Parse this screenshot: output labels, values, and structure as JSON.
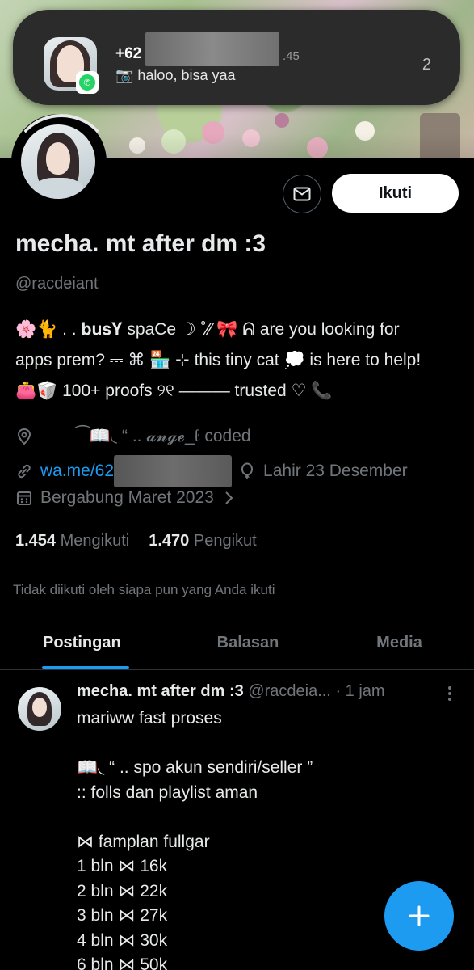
{
  "notification": {
    "title_prefix": "+62",
    "time_suffix": ".45",
    "message": "📷 haloo, bisa yaa",
    "count": "2",
    "app_icon": "whatsapp-icon"
  },
  "profile": {
    "follow_label": "Ikuti",
    "message_icon": "mail-icon",
    "name": "mecha. mt after dm :3",
    "handle": "@racdeiant",
    "bio_lines": [
      "🌸🐈 . . 𝐛𝐮𝐬𝐘 spaCe ☽ ˚⁄⁄ 🎀 ᕱ are you looking for",
      "apps prem? ⎓ ⌘ 🏪 ⊹ this tiny cat 💭 is here to help!",
      "👛🥡 100+ proofs ୨୧ ——— trusted ♡ 📞"
    ],
    "location": "⁀📖◟ “ .. 𝓪𝓷𝓰𝓮_ℓ coded",
    "link_prefix": "wa.me/62",
    "birthday": "Lahir 23 Desember",
    "joined": "Bergabung Maret 2023",
    "following_count": "1.454",
    "following_label": "Mengikuti",
    "followers_count": "1.470",
    "followers_label": "Pengikut",
    "not_followed_note": "Tidak diikuti oleh siapa pun yang Anda ikuti"
  },
  "tabs": [
    {
      "label": "Postingan",
      "active": true
    },
    {
      "label": "Balasan",
      "active": false
    },
    {
      "label": "Media",
      "active": false
    }
  ],
  "post": {
    "author_name": "mecha. mt after dm :3",
    "author_handle": "@racdeia...",
    "time": "· 1 jam",
    "body": "mariww fast proses\n\n📖◟ “ .. spo akun sendiri/seller ”\n:: folls dan playlist aman\n\n⋈ famplan fullgar\n1 bln ⋈ 16k\n2 bln ⋈ 22k\n3 bln ⋈ 27k\n4 bln ⋈ 30k\n6 bln ⋈ 50k"
  },
  "compose": {
    "icon": "plus-icon"
  }
}
